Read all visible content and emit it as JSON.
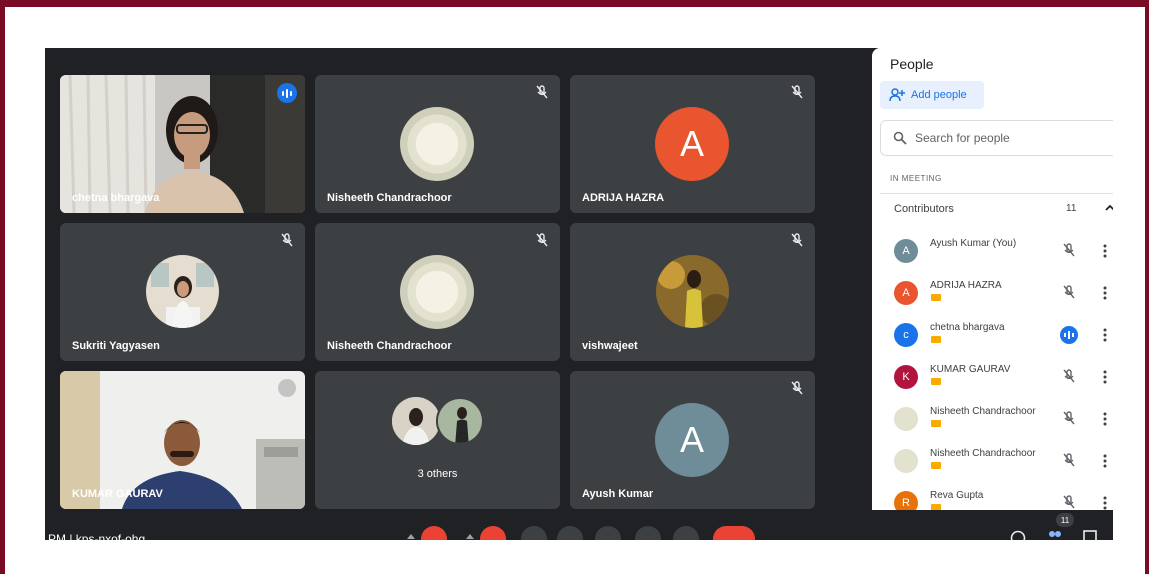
{
  "colors": {
    "frame": "#7a0b25",
    "meet_bg": "#202124",
    "tile_bg": "#3c4043",
    "active_outline": "#8ab4f8",
    "speaking_blue": "#1a73e8",
    "avatar_orange": "#e8552e",
    "avatar_grey": "#6f8c99",
    "end_call_red": "#ea4335"
  },
  "tiles": [
    {
      "name": "chetna bhargava",
      "kind": "video",
      "speaking": true
    },
    {
      "name": "Nisheeth Chandrachoor",
      "kind": "avatar-image",
      "muted": true
    },
    {
      "name": "ADRIJA HAZRA",
      "kind": "avatar-letter",
      "letter": "A",
      "muted": true
    },
    {
      "name": "Sukriti Yagyasen",
      "kind": "avatar-photo",
      "muted": true
    },
    {
      "name": "Nisheeth Chandrachoor",
      "kind": "avatar-image",
      "muted": true
    },
    {
      "name": "vishwajeet",
      "kind": "avatar-photo",
      "muted": true
    },
    {
      "name": "KUMAR GAURAV",
      "kind": "video",
      "muted": true
    },
    {
      "name": "3 others",
      "kind": "group"
    },
    {
      "name": "Ayush Kumar",
      "kind": "avatar-letter",
      "letter": "A",
      "muted": true
    }
  ],
  "panel": {
    "title": "People",
    "add_people": "Add people",
    "search_placeholder": "Search for people",
    "section": "IN MEETING",
    "contributors_label": "Contributors",
    "contributors_count": "11",
    "people": [
      {
        "name": "Ayush Kumar (You)",
        "initial": "A",
        "color": "#6f8c99",
        "badge": false,
        "status": "muted"
      },
      {
        "name": "ADRIJA HAZRA",
        "initial": "A",
        "color": "#e8552e",
        "badge": true,
        "status": "muted"
      },
      {
        "name": "chetna bhargava",
        "initial": "c",
        "color": "#1a73e8",
        "badge": true,
        "status": "speaking"
      },
      {
        "name": "KUMAR GAURAV",
        "initial": "K",
        "color": "#b0143f",
        "badge": true,
        "status": "muted"
      },
      {
        "name": "Nisheeth Chandrachoor",
        "initial": "",
        "color": "#e3e2cf",
        "badge": true,
        "status": "muted"
      },
      {
        "name": "Nisheeth Chandrachoor",
        "initial": "",
        "color": "#e3e2cf",
        "badge": true,
        "status": "muted"
      },
      {
        "name": "Reva Gupta",
        "initial": "R",
        "color": "#e8710a",
        "badge": true,
        "status": "muted"
      }
    ]
  },
  "bottom_bar": {
    "meeting_info": "PM  |  kps-nxof-ohg",
    "participant_count": "11"
  }
}
